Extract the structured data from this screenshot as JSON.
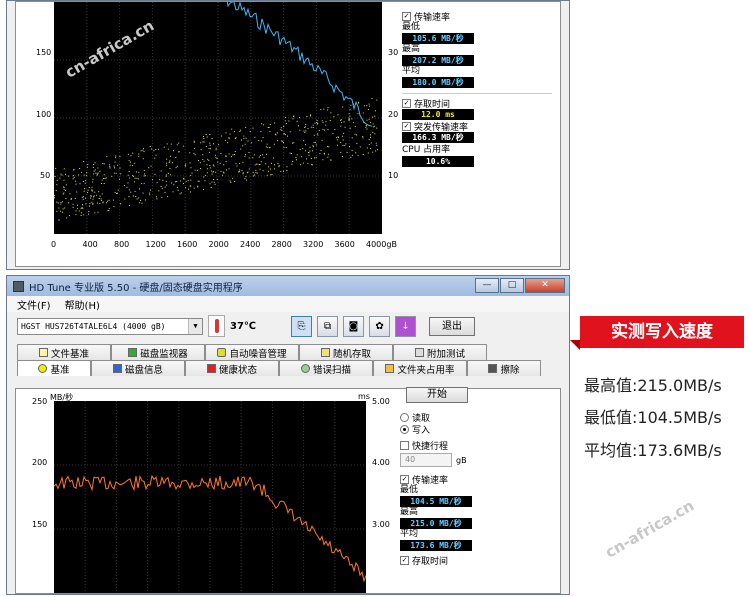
{
  "top_window": {
    "y_labels_left": [
      "150",
      "100",
      "50"
    ],
    "y_labels_right": [
      "30",
      "20",
      "10"
    ],
    "x_labels": [
      "0",
      "400",
      "800",
      "1200",
      "1600",
      "2000",
      "2400",
      "2800",
      "3200",
      "3600",
      "4000gB"
    ],
    "side": {
      "transfer_rate_label": "传输速率",
      "min_label": "最低",
      "min_value": "105.6 MB/秒",
      "max_label": "最高",
      "max_value": "207.2 MB/秒",
      "avg_label": "平均",
      "avg_value": "180.0 MB/秒",
      "access_time_label": "存取时间",
      "access_time_value": "12.0 ms",
      "burst_rate_label": "突发传输速率",
      "burst_rate_value": "166.3 MB/秒",
      "cpu_label": "CPU 占用率",
      "cpu_value": "10.6%"
    }
  },
  "bottom_window": {
    "title": "HD Tune 专业版 5.50 - 硬盘/固态硬盘实用程序",
    "window_buttons": [
      "—",
      "□",
      "✕"
    ],
    "menu": [
      "文件(F)",
      "帮助(H)"
    ],
    "drive": "HGST HUS726T4TALE6L4 (4000 gB)",
    "temperature": "37℃",
    "exit_label": "退出",
    "tabs_row1": [
      "文件基准",
      "磁盘监视器",
      "自动噪音管理",
      "随机存取",
      "附加测试"
    ],
    "tabs_row2": [
      "基准",
      "磁盘信息",
      "健康状态",
      "错误扫描",
      "文件夹占用率",
      "擦除"
    ],
    "chart": {
      "unit_left": "MB/秒",
      "unit_right": "ms",
      "y_labels_left": [
        "250",
        "200",
        "150"
      ],
      "y_labels_right": [
        "5.00",
        "4.00",
        "3.00"
      ]
    },
    "side": {
      "start_label": "开始",
      "read_label": "读取",
      "write_label": "写入",
      "short_stroke_label": "快捷行程",
      "short_stroke_value": "40",
      "short_stroke_unit": "gB",
      "transfer_rate_label": "传输速率",
      "min_label": "最低",
      "min_value": "104.5 MB/秒",
      "max_label": "最高",
      "max_value": "215.0 MB/秒",
      "avg_label": "平均",
      "avg_value": "173.6 MB/秒",
      "access_time_label": "存取时间"
    }
  },
  "promo": {
    "badge": "实测写入速度",
    "max": "最高值:215.0MB/s",
    "min": "最低值:104.5MB/s",
    "avg": "平均值:173.6MB/s"
  },
  "watermark": "cn-africa.cn",
  "colors": {
    "read_line": "#3db8f0",
    "write_line": "#ff7a20",
    "access_dots": "#e8e840",
    "badge": "#e0121e"
  }
}
